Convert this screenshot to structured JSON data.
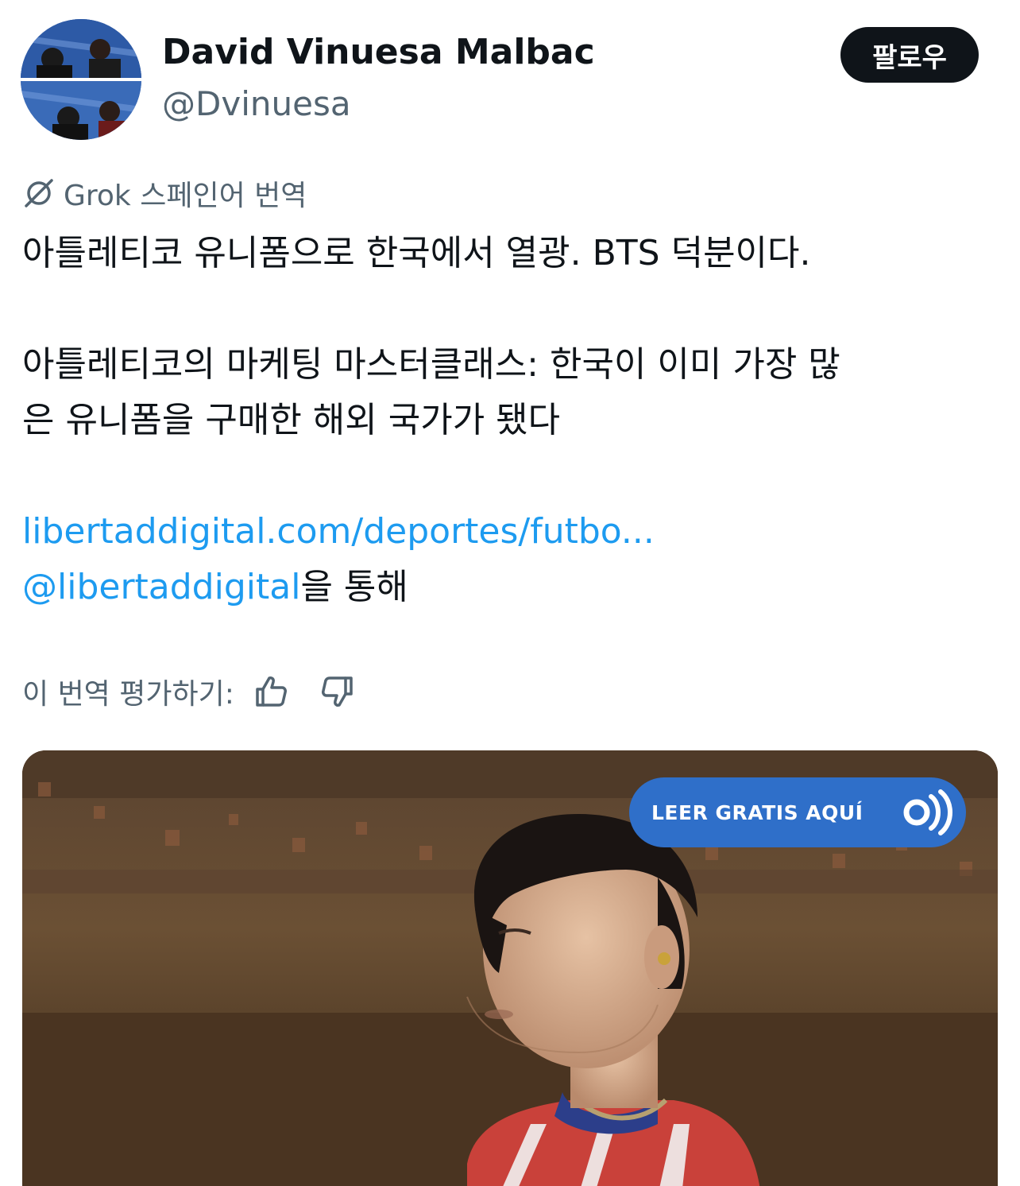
{
  "author": {
    "display_name": "David Vinuesa Malbac",
    "handle": "@Dvinuesa",
    "follow_label": "팔로우"
  },
  "translation": {
    "label": "Grok 스페인어 번역",
    "icon": "grok-icon"
  },
  "tweet": {
    "paragraph1": "아틀레티코 유니폼으로 한국에서 열광. BTS 덕분이다.",
    "paragraph2_line1": "아틀레티코의 마케팅 마스터클래스: 한국이 이미 가장 많",
    "paragraph2_line2": "은 유니폼을 구매한 해외 국가가 됐다",
    "link": "libertaddigital.com/deportes/futbo...",
    "mention": "@libertaddigital",
    "via_suffix": "을 통해"
  },
  "rating": {
    "label": "이 번역 평가하기:",
    "like_icon": "thumbs-up-icon",
    "dislike_icon": "thumbs-down-icon"
  },
  "media": {
    "badge_label": "LEER GRATIS AQUÍ",
    "badge_icon": "sound-waves-icon",
    "badge_color": "#2f6fc9"
  },
  "colors": {
    "link": "#1d9bf0",
    "secondary_text": "#536471",
    "primary_text": "#0f1419"
  }
}
